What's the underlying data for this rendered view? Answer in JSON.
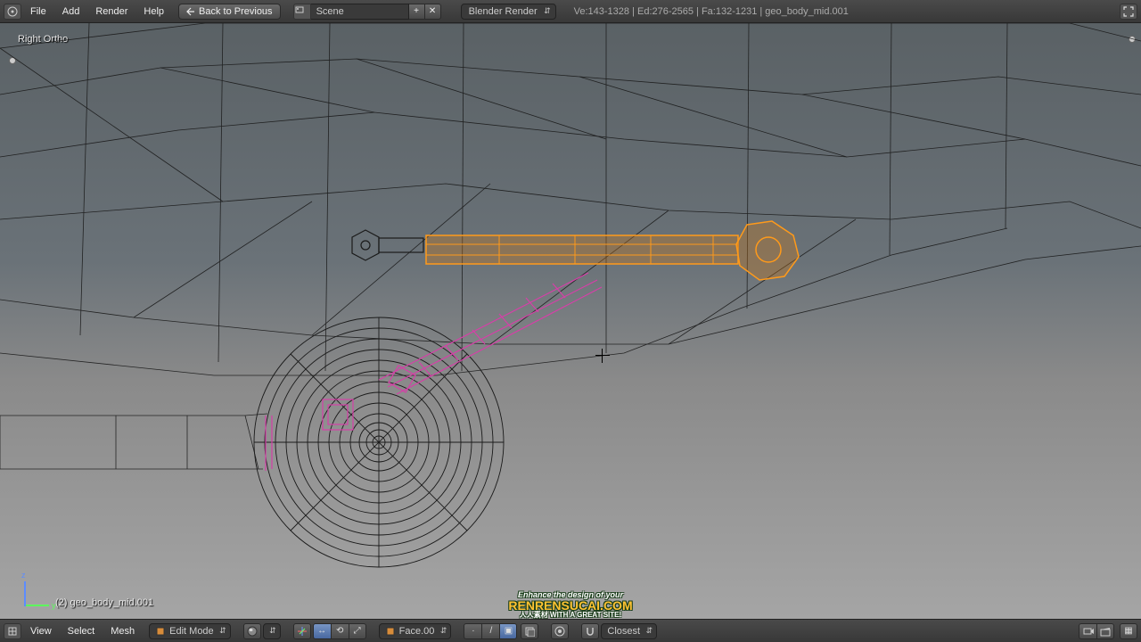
{
  "top": {
    "menus": [
      "File",
      "Add",
      "Render",
      "Help"
    ],
    "back_label": "Back to Previous",
    "scene_name": "Scene",
    "render_engine": "Blender Render",
    "stats": "Ve:143-1328 | Ed:276-2565 | Fa:132-1231 | geo_body_mid.001"
  },
  "viewport": {
    "view_label": "Right Ortho",
    "object_label": "(2) geo_body_mid.001",
    "axis_y": "y",
    "axis_z": "z"
  },
  "bottom": {
    "menus": [
      "View",
      "Select",
      "Mesh"
    ],
    "mode": "Edit Mode",
    "selmode_face": "Face.00",
    "snap_target": "Closest"
  },
  "watermark": {
    "line1": "Enhance the design of your",
    "line2": "RENRENSUCAI.COM",
    "line3": "人人素材 WITH A GREAT SITE!"
  }
}
